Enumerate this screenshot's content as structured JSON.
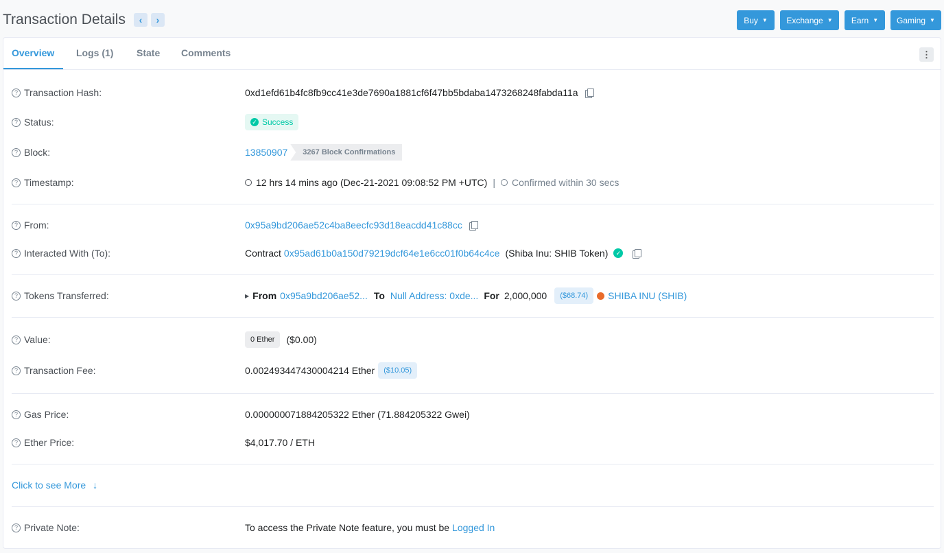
{
  "header": {
    "title": "Transaction Details",
    "prev_icon": "chevron-left-icon",
    "next_icon": "chevron-right-icon",
    "buttons": [
      "Buy",
      "Exchange",
      "Earn",
      "Gaming"
    ]
  },
  "tabs": [
    "Overview",
    "Logs (1)",
    "State",
    "Comments"
  ],
  "active_tab": "Overview",
  "colors": {
    "accent": "#3498db",
    "success": "#00c9a7"
  },
  "details": {
    "tx_hash": {
      "label": "Transaction Hash:",
      "value": "0xd1efd61b4fc8fb9cc41e3de7690a1881cf6f47bb5bdaba1473268248fabda11a"
    },
    "status": {
      "label": "Status:",
      "value": "Success"
    },
    "block": {
      "label": "Block:",
      "number": "13850907",
      "confirmations": "3267 Block Confirmations"
    },
    "timestamp": {
      "label": "Timestamp:",
      "value": "12 hrs 14 mins ago (Dec-21-2021 09:08:52 PM +UTC)",
      "separator": "|",
      "confirmed": "Confirmed within 30 secs"
    },
    "from": {
      "label": "From:",
      "value": "0x95a9bd206ae52c4ba8eecfc93d18eacdd41c88cc"
    },
    "interacted": {
      "label": "Interacted With (To):",
      "prefix": "Contract",
      "address": "0x95ad61b0a150d79219dcf64e1e6cc01f0b64c4ce",
      "name": "(Shiba Inu: SHIB Token)"
    },
    "tokens": {
      "label": "Tokens Transferred:",
      "from_label": "From",
      "from_addr": "0x95a9bd206ae52...",
      "to_label": "To",
      "to_addr": "Null Address: 0xde...",
      "for_label": "For",
      "amount": "2,000,000",
      "usd": "($68.74)",
      "token": "SHIBA INU (SHIB)"
    },
    "value": {
      "label": "Value:",
      "ether": "0 Ether",
      "usd": "($0.00)"
    },
    "fee": {
      "label": "Transaction Fee:",
      "value": "0.002493447430004214 Ether",
      "usd": "($10.05)"
    },
    "gas_price": {
      "label": "Gas Price:",
      "value": "0.000000071884205322 Ether (71.884205322 Gwei)"
    },
    "ether_price": {
      "label": "Ether Price:",
      "value": "$4,017.70 / ETH"
    },
    "more": {
      "label": "Click to see More",
      "icon": "arrow-down-icon"
    },
    "private_note": {
      "label": "Private Note:",
      "text": "To access the Private Note feature, you must be",
      "link": "Logged In"
    }
  }
}
